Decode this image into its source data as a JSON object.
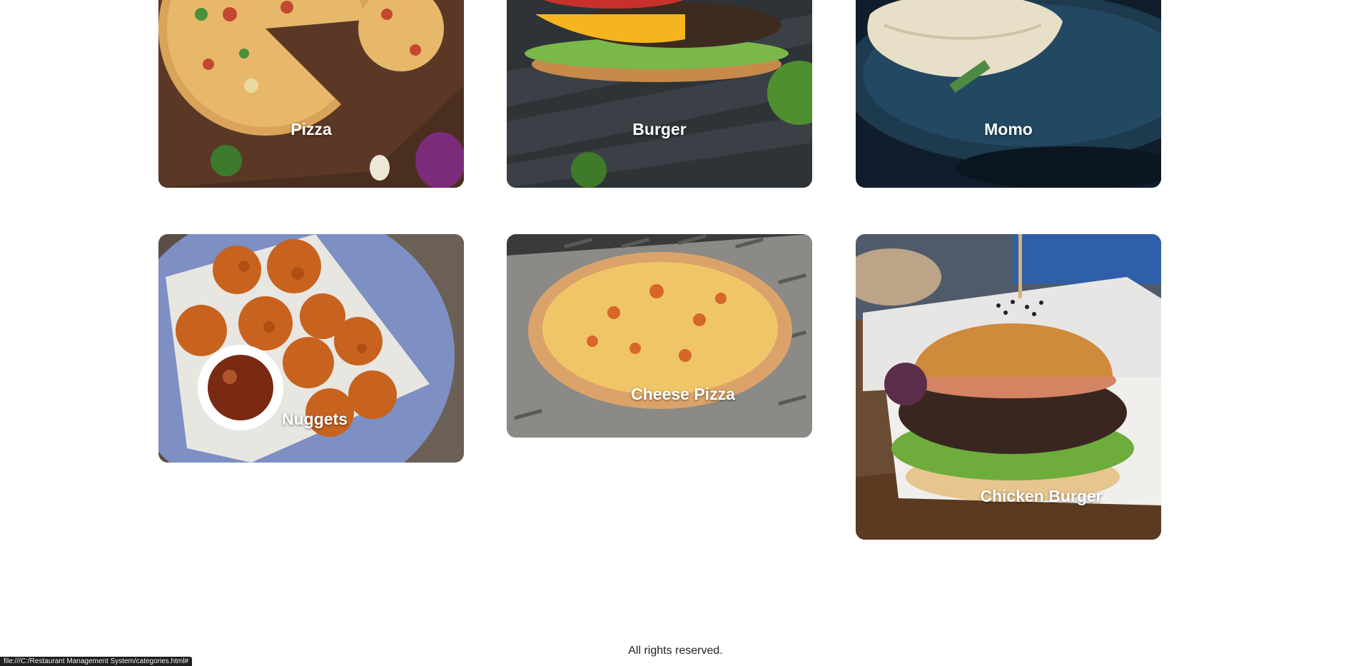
{
  "categories": [
    {
      "id": "pizza",
      "label": "Pizza",
      "icon": "pizza-photo"
    },
    {
      "id": "burger",
      "label": "Burger",
      "icon": "burger-photo"
    },
    {
      "id": "momo",
      "label": "Momo",
      "icon": "momo-photo"
    },
    {
      "id": "nuggets",
      "label": "Nuggets",
      "icon": "nuggets-photo"
    },
    {
      "id": "cheese-pizza",
      "label": "Cheese Pizza",
      "icon": "cheese-pizza-photo"
    },
    {
      "id": "chicken-burger",
      "label": "Chicken Burger",
      "icon": "chicken-burger-photo"
    }
  ],
  "footer": {
    "text": "All rights reserved."
  },
  "status_bar": {
    "url": "file:///C:/Restaurant Management System/categories.html#"
  },
  "colors": {
    "page_background": "#ffffff",
    "label_text": "#ffffff",
    "footer_text": "#222222",
    "status_bar_background": "#1f1f1f"
  }
}
